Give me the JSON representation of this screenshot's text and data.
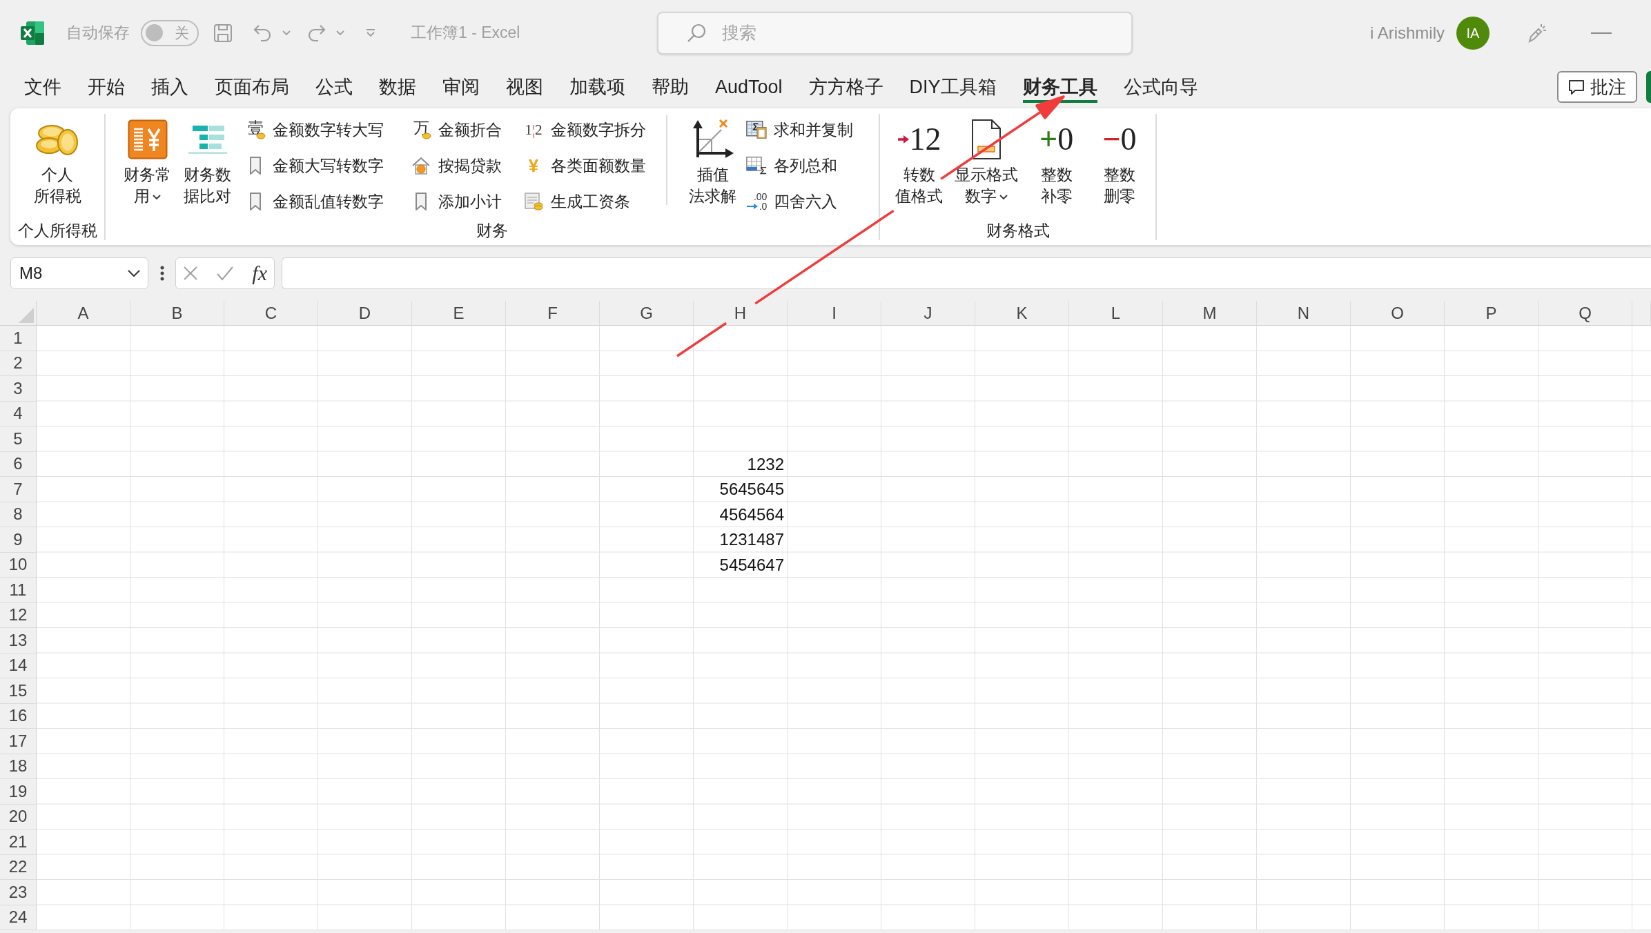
{
  "title_bar": {
    "autosave": {
      "label": "自动保存",
      "on": false,
      "state_label": "关"
    },
    "document_title": "工作簿1 - Excel",
    "search": {
      "placeholder": "搜索"
    },
    "user": {
      "name": "i Arishmily",
      "initials": "IA"
    }
  },
  "ribbon_tabs": [
    {
      "label": "文件",
      "selected": false
    },
    {
      "label": "开始",
      "selected": false
    },
    {
      "label": "插入",
      "selected": false
    },
    {
      "label": "页面布局",
      "selected": false
    },
    {
      "label": "公式",
      "selected": false
    },
    {
      "label": "数据",
      "selected": false
    },
    {
      "label": "审阅",
      "selected": false
    },
    {
      "label": "视图",
      "selected": false
    },
    {
      "label": "加载项",
      "selected": false
    },
    {
      "label": "帮助",
      "selected": false
    },
    {
      "label": "AudTool",
      "selected": false
    },
    {
      "label": "方方格子",
      "selected": false
    },
    {
      "label": "DIY工具箱",
      "selected": false
    },
    {
      "label": "财务工具",
      "selected": true
    },
    {
      "label": "公式向导",
      "selected": false
    }
  ],
  "comment_button": {
    "label": "批注"
  },
  "ribbon": {
    "groups": [
      {
        "label": "个人所得税",
        "blocks": [
          {
            "kind": "large",
            "label": "个人所得税",
            "dropdown": false
          }
        ]
      },
      {
        "label": "财务",
        "blocks": [
          {
            "kind": "large",
            "label": "财务常用",
            "dropdown": true
          },
          {
            "kind": "large",
            "label": "财务数据比对",
            "dropdown": false
          },
          {
            "kind": "stack",
            "items": [
              {
                "label": "金额数字转大写",
                "glyph": "壹"
              },
              {
                "label": "金额大写转数字"
              },
              {
                "label": "金额乱值转数字"
              }
            ]
          },
          {
            "kind": "stack",
            "items": [
              {
                "label": "金额折合",
                "glyph": "万"
              },
              {
                "label": "按揭贷款"
              },
              {
                "label": "添加小计"
              }
            ]
          },
          {
            "kind": "stack",
            "items": [
              {
                "label": "金额数字拆分",
                "glyph": "1¦2"
              },
              {
                "label": "各类面额数量",
                "glyph": "¥"
              },
              {
                "label": "生成工资条"
              }
            ]
          },
          {
            "kind": "separator"
          },
          {
            "kind": "large",
            "label": "插值法求解",
            "dropdown": false
          },
          {
            "kind": "stack",
            "items": [
              {
                "label": "求和并复制"
              },
              {
                "label": "各列总和"
              },
              {
                "label": "四舍六入",
                "glyph": ".00.0"
              }
            ]
          }
        ]
      },
      {
        "label": "财务格式",
        "blocks": [
          {
            "kind": "large",
            "label": "转数值格式",
            "dropdown": false,
            "glyph": "12"
          },
          {
            "kind": "large",
            "label": "显示格式数字",
            "dropdown": true
          },
          {
            "kind": "large",
            "label": "整数补零",
            "dropdown": false,
            "glyph": "+0"
          },
          {
            "kind": "large",
            "label": "整数删零",
            "dropdown": false,
            "glyph": "−0"
          }
        ]
      }
    ]
  },
  "formula_bar": {
    "name_box": "M8",
    "function_label": "fx"
  },
  "sheet": {
    "columns": [
      "A",
      "B",
      "C",
      "D",
      "E",
      "F",
      "G",
      "H",
      "I",
      "J",
      "K",
      "L",
      "M",
      "N",
      "O",
      "P",
      "Q"
    ],
    "rows": [
      {
        "header": "1"
      },
      {
        "header": "2"
      },
      {
        "header": "3"
      },
      {
        "header": "4"
      },
      {
        "header": "5"
      },
      {
        "header": "6",
        "cells": [
          null,
          null,
          null,
          null,
          null,
          null,
          null,
          "1232"
        ]
      },
      {
        "header": "7",
        "cells": [
          null,
          null,
          null,
          null,
          null,
          null,
          null,
          "5645645"
        ]
      },
      {
        "header": "8",
        "cells": [
          null,
          null,
          null,
          null,
          null,
          null,
          null,
          "4564564"
        ]
      },
      {
        "header": "9",
        "cells": [
          null,
          null,
          null,
          null,
          null,
          null,
          null,
          "1231487"
        ]
      },
      {
        "header": "10",
        "cells": [
          null,
          null,
          null,
          null,
          null,
          null,
          null,
          "5454647"
        ]
      },
      {
        "header": "11"
      },
      {
        "header": "12"
      },
      {
        "header": "13"
      },
      {
        "header": "14"
      },
      {
        "header": "15"
      },
      {
        "header": "16"
      },
      {
        "header": "17"
      },
      {
        "header": "18"
      },
      {
        "header": "19"
      },
      {
        "header": "20"
      },
      {
        "header": "21"
      },
      {
        "header": "22"
      },
      {
        "header": "23"
      },
      {
        "header": "24"
      }
    ]
  }
}
